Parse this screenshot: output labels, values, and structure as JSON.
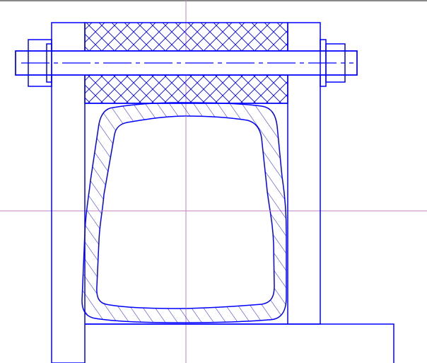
{
  "drawing": {
    "view": "cross-section",
    "colors": {
      "background": "#ffffff",
      "outline": "#0000ff",
      "crosshair": "#c080c0",
      "frame_top": "#606060"
    },
    "hatch_patterns": [
      "crosshatch",
      "diagonal"
    ]
  }
}
